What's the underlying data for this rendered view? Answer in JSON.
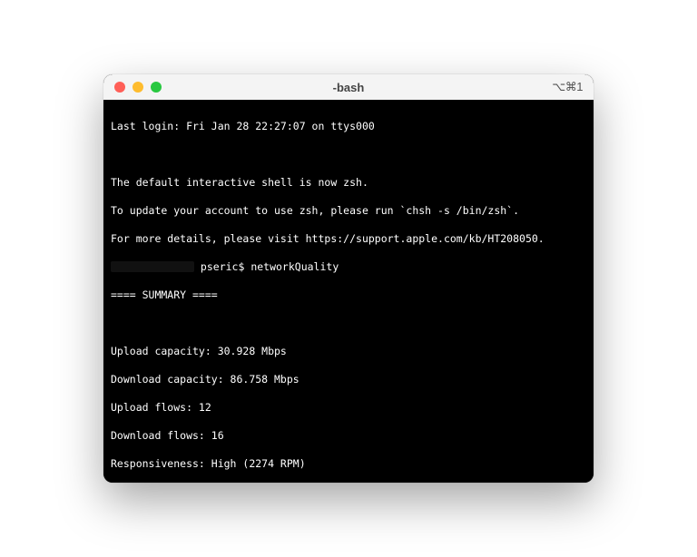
{
  "window": {
    "title": "-bash",
    "shortcut": "⌥⌘1"
  },
  "terminal": {
    "last_login": "Last login: Fri Jan 28 22:27:07 on ttys000",
    "notice_l1": "The default interactive shell is now zsh.",
    "notice_l2": "To update your account to use zsh, please run `chsh -s /bin/zsh`.",
    "notice_l3": "For more details, please visit https://support.apple.com/kb/HT208050.",
    "prompt_user": " pseric$ ",
    "command": "networkQuality",
    "summary_header": "==== SUMMARY ====",
    "results": {
      "upload_capacity": "Upload capacity: 30.928 Mbps",
      "download_capacity": "Download capacity: 86.758 Mbps",
      "upload_flows": "Upload flows: 12",
      "download_flows": "Download flows: 16",
      "responsiveness": "Responsiveness: High (2274 RPM)"
    }
  }
}
